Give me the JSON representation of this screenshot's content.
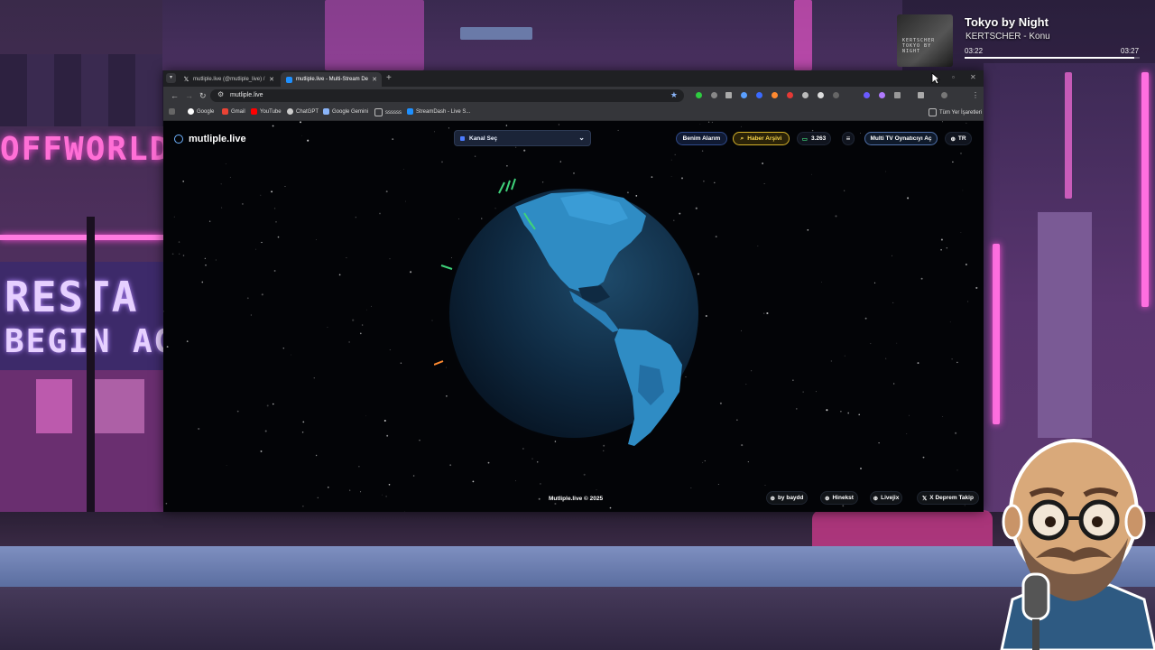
{
  "music": {
    "title": "Tokyo by Night",
    "artist": "KERTSCHER - Konu",
    "time_current": "03:22",
    "time_total": "03:27",
    "progress": 0.97,
    "art_text": "KERTSCHER TOKYO BY NIGHT"
  },
  "browser": {
    "tabs": [
      {
        "label": "mutliple.live (@mutliple_live) /",
        "active": false
      },
      {
        "label": "mutliple.live - Multi-Stream De",
        "active": true
      }
    ],
    "url": "mutliple.live",
    "bookmarks": [
      "Google",
      "Gmail",
      "YouTube",
      "ChatGPT",
      "Google Gemini",
      "ssssss",
      "StreamDash - Live S..."
    ],
    "all_bookmarks_label": "Tüm Yer İşaretleri"
  },
  "site": {
    "logo": "mutliple.live",
    "channel_select": "Kanal Seç",
    "alarm_button": "Benim Alarım",
    "archive_button": "Haber Arşivi",
    "viewer_count": "3.263",
    "multitv_button": "Multi TV Oynatıcıyı Aç",
    "lang": "TR",
    "copyright": "Mutliple.live © 2025",
    "footer_links": [
      "by baydd",
      "Hinekst",
      "Livejix",
      "X Deprem Takip"
    ]
  },
  "background": {
    "sign_offworld": "OFFWORLD",
    "sign_restart": "RESTA",
    "sign_begin": "BEGIN AG"
  },
  "colors": {
    "accent_blue": "#3aa0e0",
    "archive_yellow": "#f5d24a",
    "neon_pink": "#ff4fd8"
  }
}
